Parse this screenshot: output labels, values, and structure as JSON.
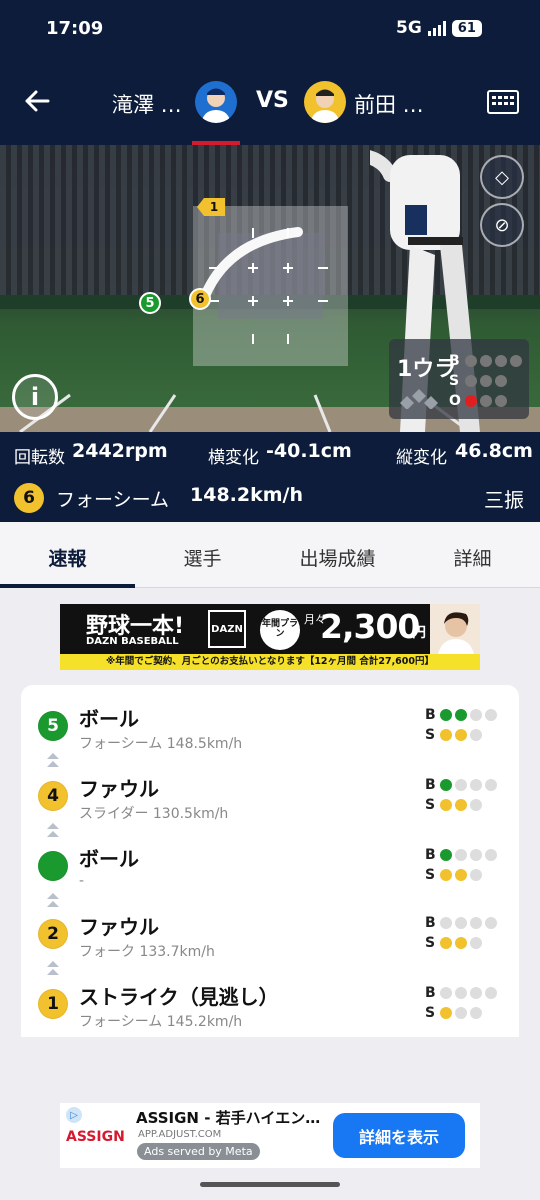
{
  "status_bar": {
    "time": "17:09",
    "network": "5G",
    "battery": "61"
  },
  "header": {
    "pitcher_name": "滝澤 …",
    "vs_label": "VS",
    "batter_name": "前田 …"
  },
  "field": {
    "pitch_marker_1": "1",
    "pitch_marker_5": "5",
    "pitch_marker_6": "6",
    "count": {
      "inning": "1ウラ",
      "b_label": "B",
      "s_label": "S",
      "o_label": "O"
    }
  },
  "stats": {
    "spin_label": "回転数",
    "spin_value": "2442rpm",
    "hbreak_label": "横変化",
    "hbreak_value": "-40.1cm",
    "vbreak_label": "縦変化",
    "vbreak_value": "46.8cm",
    "pitch_no": "6",
    "pitch_type": "フォーシーム",
    "pitch_speed": "148.2km/h",
    "result": "三振"
  },
  "tabs": [
    "速報",
    "選手",
    "出場成績",
    "詳細"
  ],
  "banner": {
    "headline": "野球一本!",
    "brand": "DAZN BASEBALL",
    "dazn": "DAZN",
    "plan": "年間プラン",
    "monthly": "月々",
    "price": "2,300",
    "yen": "円",
    "note": "※年間でご契約、月ごとのお支払いとなります【12ヶ月間 合計27,600円】"
  },
  "pitches": [
    {
      "num": "5",
      "title": "ボール",
      "sub": "フォーシーム 148.5km/h",
      "color": "#1a9a2e",
      "text_color": "#ffffff",
      "balls": 2,
      "strikes": 2
    },
    {
      "num": "4",
      "title": "ファウル",
      "sub": "スライダー 130.5km/h",
      "color": "#f2c12e",
      "text_color": "#111111",
      "balls": 1,
      "strikes": 2
    },
    {
      "num": "",
      "title": "ボール",
      "sub": "-",
      "color": "#1a9a2e",
      "text_color": "#ffffff",
      "balls": 1,
      "strikes": 2
    },
    {
      "num": "2",
      "title": "ファウル",
      "sub": "フォーク 133.7km/h",
      "color": "#f2c12e",
      "text_color": "#111111",
      "balls": 0,
      "strikes": 2
    },
    {
      "num": "1",
      "title": "ストライク（見逃し）",
      "sub": "フォーシーム 145.2km/h",
      "color": "#f2c12e",
      "text_color": "#111111",
      "balls": 0,
      "strikes": 1
    }
  ],
  "bs_labels": {
    "b": "B",
    "s": "S"
  },
  "ad": {
    "title": "ASSIGN - 若手ハイエン…",
    "url": "APP.ADJUST.COM",
    "served": "Ads served by Meta",
    "logo": "ASSIGN",
    "cta": "詳細を表示"
  },
  "colors": {
    "navy": "#0c1c3a",
    "accent_red": "#d5192f",
    "ball_green": "#1a9a2e",
    "strike_yellow": "#f2c12e",
    "cta_blue": "#1877f2"
  }
}
